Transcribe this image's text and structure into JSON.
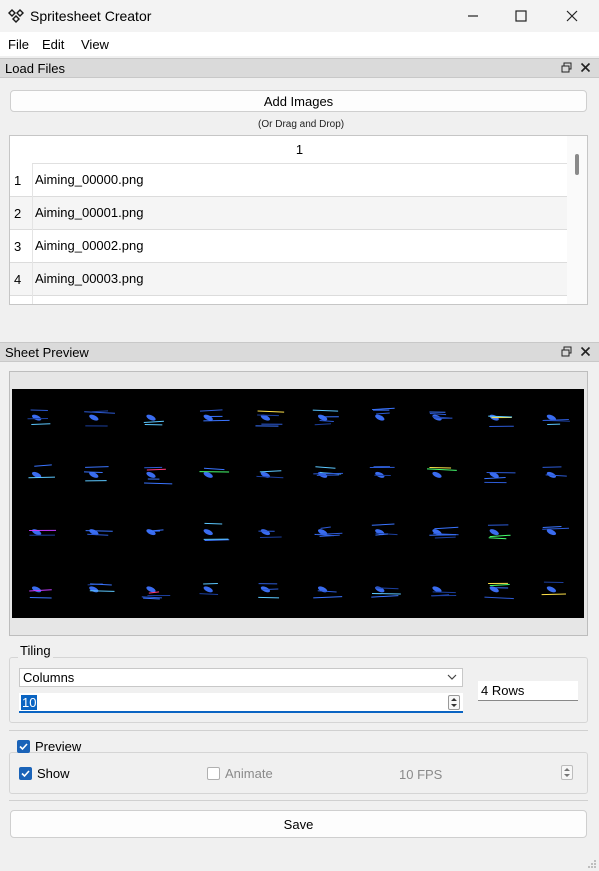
{
  "window": {
    "title": "Spritesheet Creator",
    "controls": [
      "minimize",
      "maximize",
      "close"
    ]
  },
  "menu": {
    "items": [
      {
        "label": "File"
      },
      {
        "label": "Edit"
      },
      {
        "label": "View"
      }
    ]
  },
  "load_files": {
    "title": "Load Files",
    "add_button": "Add Images",
    "drag_hint": "(Or Drag and Drop)",
    "table": {
      "column_header": "1",
      "rows": [
        {
          "num": "1",
          "file": "Aiming_00000.png"
        },
        {
          "num": "2",
          "file": "Aiming_00001.png"
        },
        {
          "num": "3",
          "file": "Aiming_00002.png"
        },
        {
          "num": "4",
          "file": "Aiming_00003.png"
        }
      ]
    }
  },
  "sheet_preview": {
    "title": "Sheet Preview",
    "grid": {
      "columns": 10,
      "rows": 4
    },
    "background": "#000000"
  },
  "tiling": {
    "title": "Tiling",
    "mode": "Columns",
    "value": "10",
    "rows_text": "4 Rows"
  },
  "preview": {
    "title": "Preview",
    "checked": true,
    "show_label": "Show",
    "show_checked": true,
    "animate_label": "Animate",
    "animate_checked": false,
    "fps_text": "10 FPS"
  },
  "save_button": "Save",
  "colors": {
    "accent": "#1a63b8",
    "selection": "#0a64c2",
    "dock_header": "#dadada"
  },
  "icons": {
    "app": "app-logo-icon",
    "minimize": "minimize-icon",
    "maximize": "maximize-icon",
    "close": "close-icon",
    "float": "float-icon",
    "chevron": "chevron-down-icon",
    "spin": "spin-arrows-icon"
  }
}
